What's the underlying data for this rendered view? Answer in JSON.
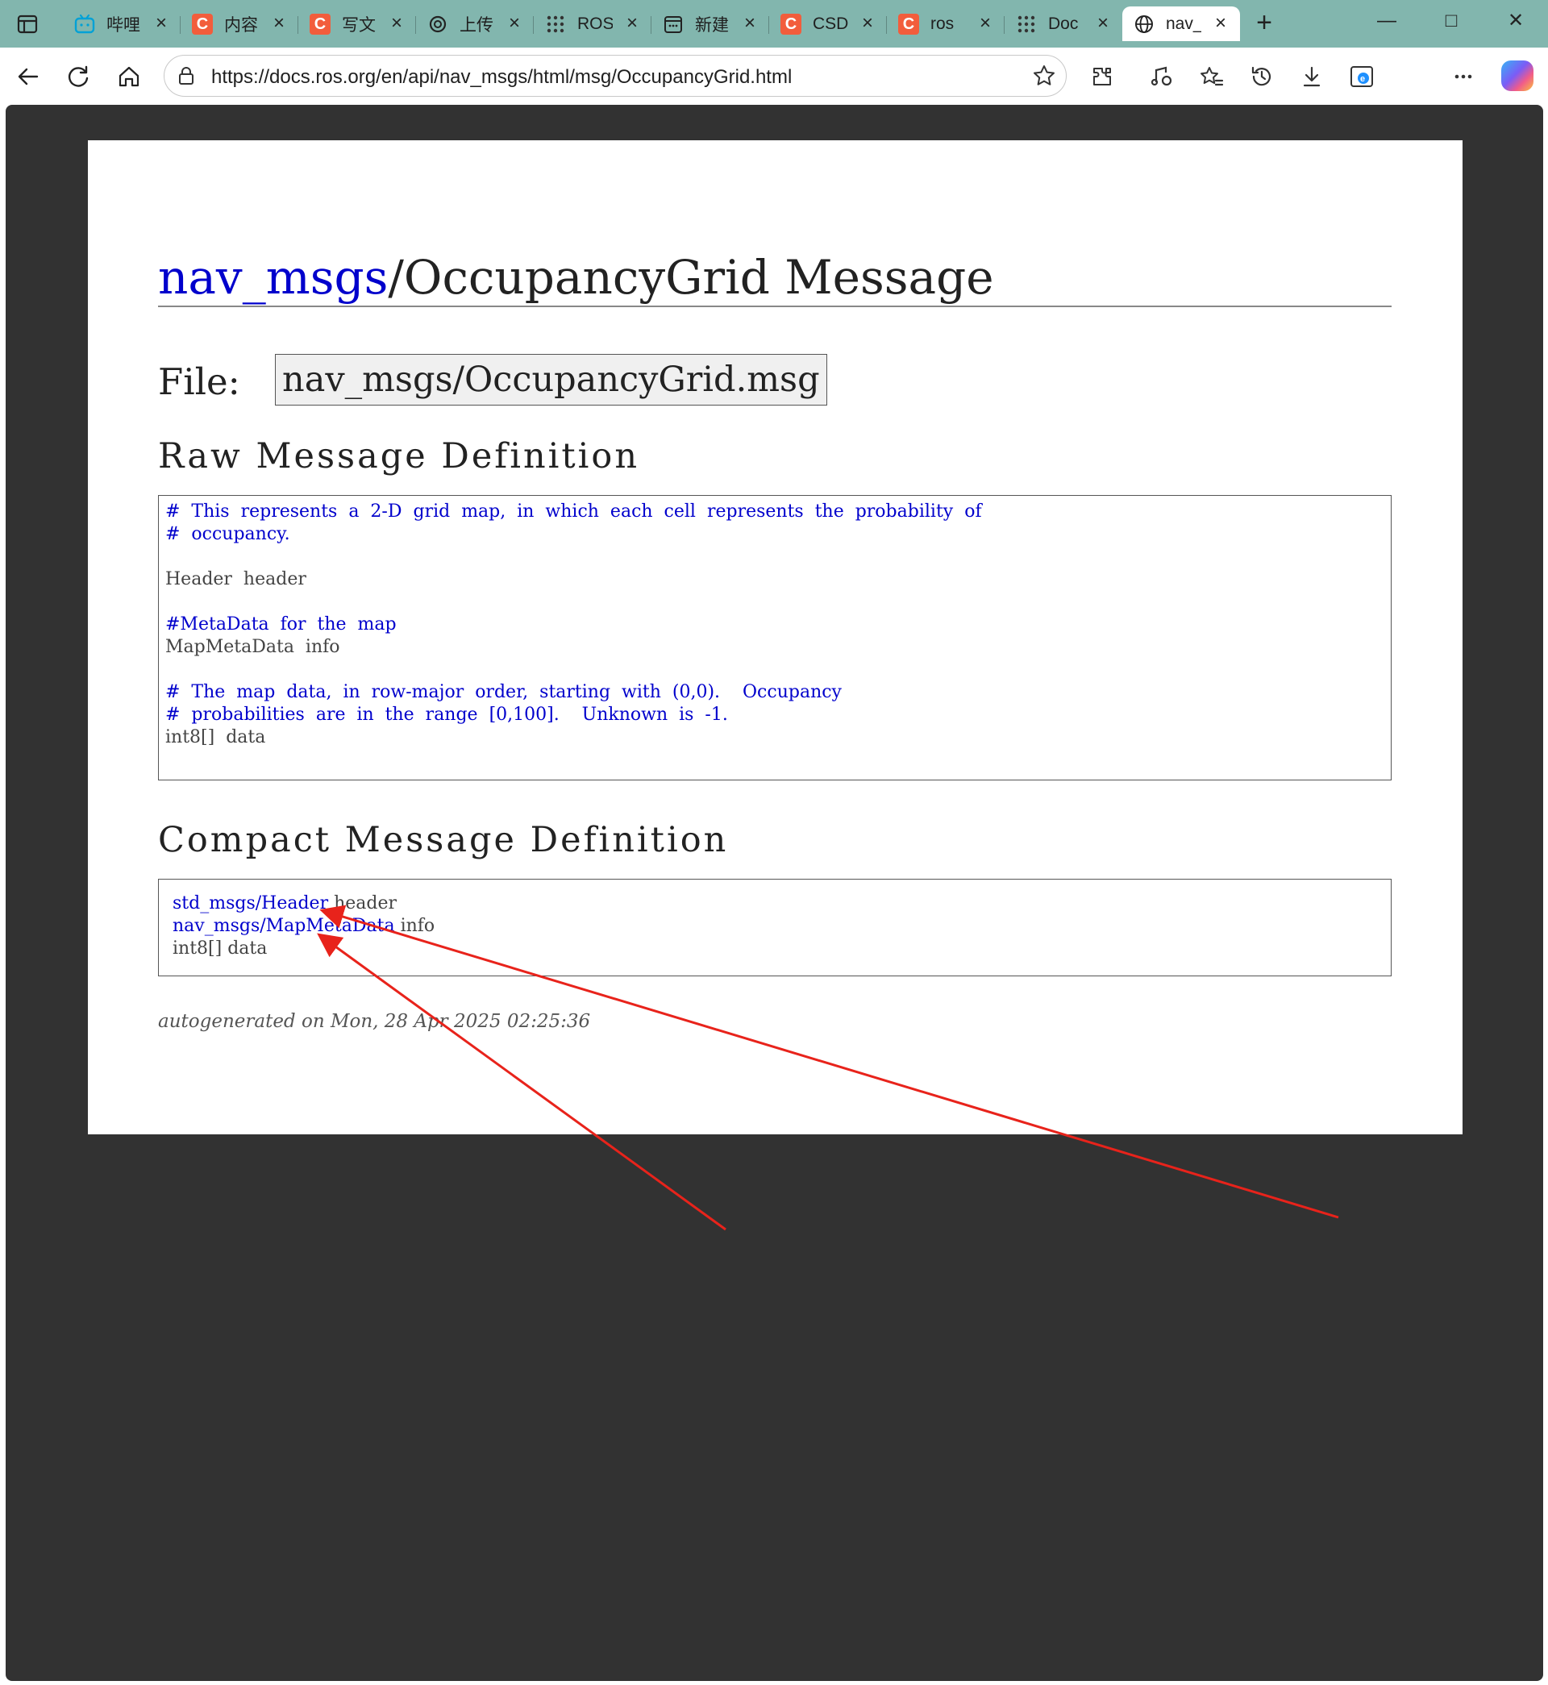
{
  "tabs": [
    {
      "title": "哔哩",
      "icon": "bilibili-icon"
    },
    {
      "title": "内容",
      "icon": "csdn-icon"
    },
    {
      "title": "写文",
      "icon": "csdn-icon"
    },
    {
      "title": "上传",
      "icon": "openai-icon"
    },
    {
      "title": "ROS",
      "icon": "grid-dots-icon"
    },
    {
      "title": "新建",
      "icon": "calendar-icon"
    },
    {
      "title": "CSD",
      "icon": "csdn-icon"
    },
    {
      "title": "ros",
      "icon": "csdn-icon"
    },
    {
      "title": "Doc",
      "icon": "grid-dots-icon"
    },
    {
      "title": "nav_",
      "icon": "globe-icon",
      "active": true
    }
  ],
  "address_bar": {
    "url": "https://docs.ros.org/en/api/nav_msgs/html/msg/OccupancyGrid.html"
  },
  "colors": {
    "tabstrip": "#82b6ae",
    "link": "#0000cc",
    "viewport_bg": "#323232",
    "annotation_arrow": "#e8231b"
  },
  "page": {
    "title_link": "nav_msgs",
    "title_rest": "/OccupancyGrid Message",
    "file_label": "File:",
    "file_name": "nav_msgs/OccupancyGrid.msg",
    "raw_heading": "Raw Message Definition",
    "raw_lines": [
      {
        "text": "#  This  represents  a  2-D  grid  map,  in  which  each  cell  represents  the  probability  of",
        "comment": true
      },
      {
        "text": "#  occupancy.",
        "comment": true
      },
      {
        "text": "",
        "comment": false
      },
      {
        "text": "Header  header",
        "comment": false
      },
      {
        "text": "",
        "comment": false
      },
      {
        "text": "#MetaData  for  the  map",
        "comment": true
      },
      {
        "text": "MapMetaData  info",
        "comment": false
      },
      {
        "text": "",
        "comment": false
      },
      {
        "text": "#  The  map  data,  in  row-major  order,  starting  with  (0,0).    Occupancy",
        "comment": true
      },
      {
        "text": "#  probabilities  are  in  the  range  [0,100].    Unknown  is  -1.",
        "comment": true
      },
      {
        "text": "int8[]  data",
        "comment": false
      }
    ],
    "compact_heading": "Compact Message Definition",
    "compact_lines": [
      {
        "type_link": "std_msgs/Header",
        "field": " header"
      },
      {
        "type_link": "nav_msgs/MapMetaData",
        "field": " info"
      },
      {
        "type_text": "int8[]",
        "field": " data"
      }
    ],
    "footer": "autogenerated on Mon, 28 Apr 2025 02:25:36"
  }
}
